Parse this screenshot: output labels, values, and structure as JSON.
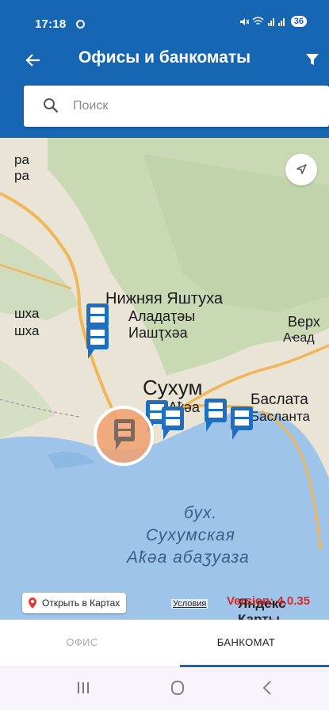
{
  "status_bar": {
    "time": "17:18",
    "battery": "36",
    "signal_text": "✕ ⌇ ▌▌"
  },
  "header": {
    "title": "Офисы и банкоматы"
  },
  "search": {
    "placeholder": "Поиск"
  },
  "map": {
    "labels": {
      "city_main": "Сухум",
      "city_main_alt": "Аҟәа",
      "village_1": "Нижняя Яштуха",
      "village_1_alt1": "Аладаҭәы",
      "village_1_alt2": "Иашҭхәа",
      "village_2": "Баслата",
      "village_2_alt": "Басланта",
      "upper_right": "Верх",
      "upper_right_alt": "Аҽад",
      "left_top_1": "ра",
      "left_top_2": "ра",
      "left_mid_1": "шха",
      "left_mid_2": "шха",
      "bay_1": "бух.",
      "bay_2": "Сухумская",
      "bay_3": "Аҟәа абаӡуаза"
    },
    "open_in_maps": "Открыть в Картах",
    "terms": "Условия",
    "version": "Version: 4.0.35",
    "yandex": "Яндекс Карты",
    "colors": {
      "land": "#e9e4d6",
      "forest": "#c9d9b4",
      "sea": "#9fc4ea",
      "road": "#f0b75a",
      "pin": "#1f6fc0",
      "cluster": "#f0a06e"
    }
  },
  "tabs": [
    {
      "label": "ОФИС"
    },
    {
      "label": "БАНКОМАТ"
    }
  ],
  "nav": {
    "recent": "|||",
    "home": "○",
    "back": "<"
  }
}
